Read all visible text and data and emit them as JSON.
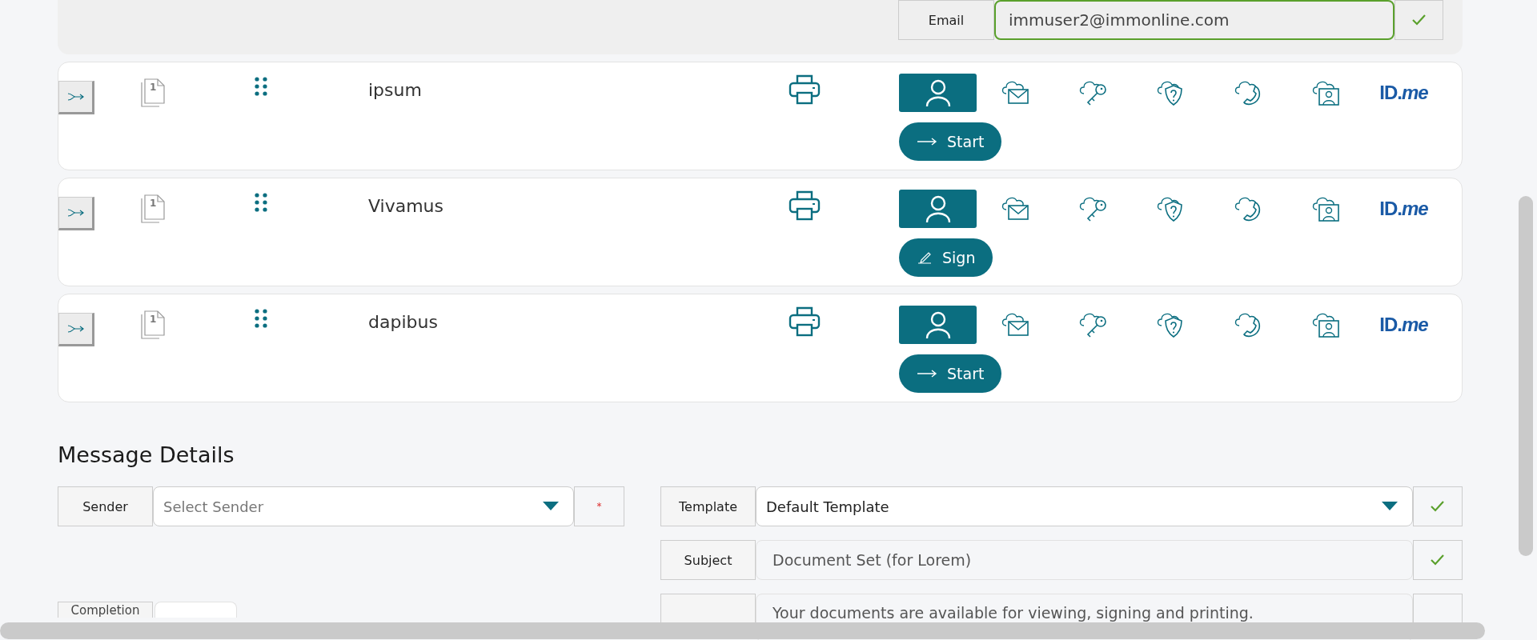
{
  "email": {
    "label": "Email",
    "value": "immuser2@immonline.com",
    "valid": true
  },
  "recipients": [
    {
      "name": "ipsum",
      "page_count": "1",
      "action": {
        "kind": "start",
        "label": "Start"
      },
      "auth_methods": [
        {
          "kind": "person",
          "selected": true
        },
        {
          "kind": "cloud-mail",
          "selected": false
        },
        {
          "kind": "cloud-key",
          "selected": false
        },
        {
          "kind": "cloud-shield",
          "selected": false
        },
        {
          "kind": "cloud-phone",
          "selected": false
        },
        {
          "kind": "cloud-id",
          "selected": false
        },
        {
          "kind": "idme",
          "label": "ID.*me*",
          "selected": false
        }
      ]
    },
    {
      "name": "Vivamus",
      "page_count": "1",
      "action": {
        "kind": "sign",
        "label": "Sign"
      },
      "auth_methods": [
        {
          "kind": "person",
          "selected": true
        },
        {
          "kind": "cloud-mail",
          "selected": false
        },
        {
          "kind": "cloud-key",
          "selected": false
        },
        {
          "kind": "cloud-shield",
          "selected": false
        },
        {
          "kind": "cloud-phone",
          "selected": false
        },
        {
          "kind": "cloud-id",
          "selected": false
        },
        {
          "kind": "idme",
          "label": "ID.*me*",
          "selected": false
        }
      ]
    },
    {
      "name": "dapibus",
      "page_count": "1",
      "action": {
        "kind": "start",
        "label": "Start"
      },
      "auth_methods": [
        {
          "kind": "person",
          "selected": true
        },
        {
          "kind": "cloud-mail",
          "selected": false
        },
        {
          "kind": "cloud-key",
          "selected": false
        },
        {
          "kind": "cloud-shield",
          "selected": false
        },
        {
          "kind": "cloud-phone",
          "selected": false
        },
        {
          "kind": "cloud-id",
          "selected": false
        },
        {
          "kind": "idme",
          "label": "ID.*me*",
          "selected": false
        }
      ]
    }
  ],
  "message_details": {
    "title": "Message Details",
    "sender": {
      "label": "Sender",
      "placeholder": "Select Sender",
      "required": "*"
    },
    "template": {
      "label": "Template",
      "value": "Default Template",
      "valid": true
    },
    "subject": {
      "label": "Subject",
      "value": "Document Set (for Lorem)",
      "valid": true
    },
    "message": {
      "value": "Your documents are available for viewing, signing and printing."
    },
    "completion": {
      "label": "Completion"
    }
  }
}
